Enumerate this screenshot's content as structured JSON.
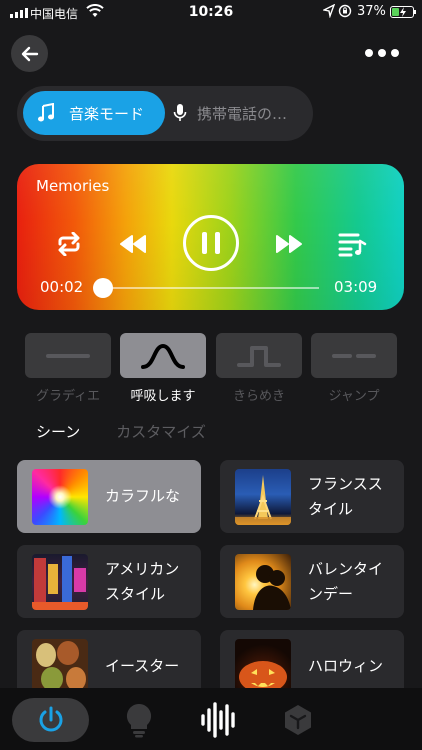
{
  "status_bar": {
    "carrier": "中国电信",
    "time": "10:26",
    "battery": "37%",
    "battery_level": 0.37
  },
  "header": {
    "back_icon": "arrow-left-icon",
    "more_icon": "more-dots-icon"
  },
  "mode_switch": {
    "music_label": "音楽モード",
    "phone_label": "携帯電話の…",
    "selected": "music"
  },
  "player": {
    "title": "Memories",
    "current_time": "00:02",
    "total_time": "03:09",
    "progress": 0.01,
    "state": "playing",
    "controls": [
      "repeat-icon",
      "rewind-icon",
      "pause-icon",
      "fast-forward-icon",
      "playlist-icon"
    ]
  },
  "effects": [
    {
      "label": "グラディエ",
      "icon": "gradient-line-icon",
      "active": false
    },
    {
      "label": "呼吸します",
      "icon": "breathe-wave-icon",
      "active": true
    },
    {
      "label": "きらめき",
      "icon": "flash-pulse-icon",
      "active": false
    },
    {
      "label": "ジャンプ",
      "icon": "jump-dashes-icon",
      "active": false
    }
  ],
  "scene_tabs": {
    "scene": "シーン",
    "custom": "カスタマイズ",
    "selected": "scene"
  },
  "scenes": [
    {
      "name": "カラフルな",
      "active": true
    },
    {
      "name": "フランススタイル",
      "active": false
    },
    {
      "name": "アメリカンスタイル",
      "active": false
    },
    {
      "name": "バレンタインデー",
      "active": false
    },
    {
      "name": "イースター",
      "active": false
    },
    {
      "name": "ハロウィン",
      "active": false
    }
  ],
  "bottom_nav": {
    "items": [
      "power-icon",
      "bulb-icon",
      "sound-wave-icon",
      "cube-icon"
    ],
    "accent": "#1aa2e6"
  }
}
